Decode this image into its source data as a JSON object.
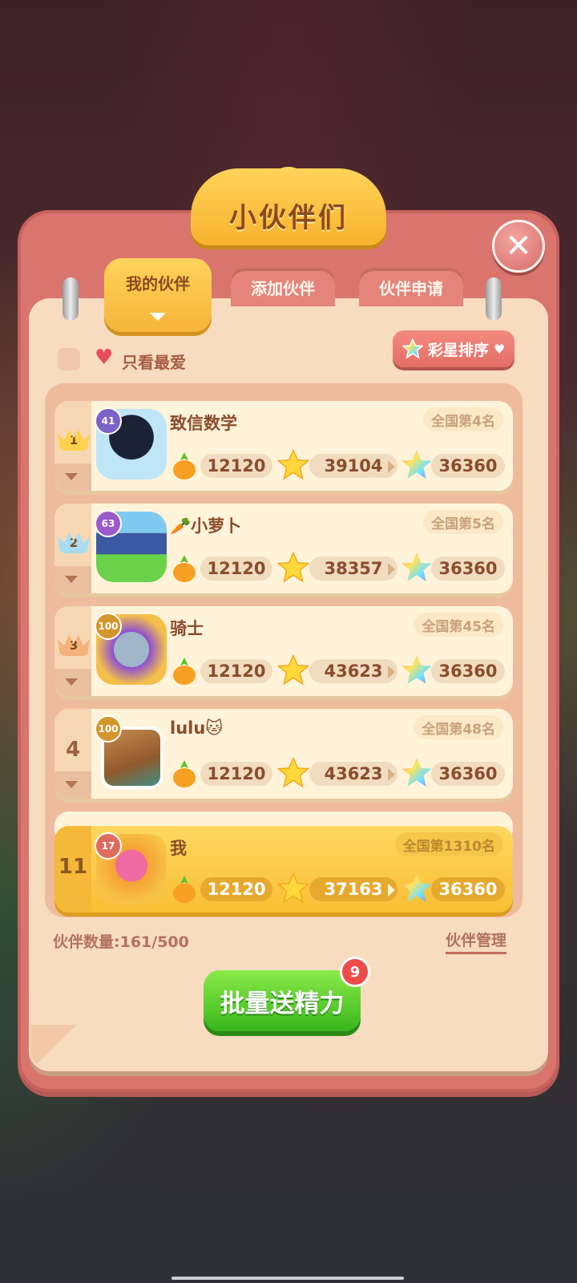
{
  "window": {
    "title": "小伙伴们"
  },
  "tabs": [
    {
      "label": "我的伙伴",
      "active": true
    },
    {
      "label": "添加伙伴",
      "active": false
    },
    {
      "label": "伙伴申请",
      "active": false
    }
  ],
  "filter": {
    "favorites_label": "只看最爱",
    "checked": false
  },
  "sort": {
    "label": "彩星排序",
    "icon": "rainbow-star-icon"
  },
  "friends": [
    {
      "rank": "1",
      "crown": "gold",
      "level": "41",
      "name": "致信数学",
      "national": "全国第4名",
      "carrots": "12120",
      "stars": "39104",
      "rainbow": "36360"
    },
    {
      "rank": "2",
      "crown": "silver",
      "level": "63",
      "name": "🥕小萝卜",
      "national": "全国第5名",
      "carrots": "12120",
      "stars": "38357",
      "rainbow": "36360"
    },
    {
      "rank": "3",
      "crown": "bronze",
      "level": "100",
      "name": "骑士",
      "national": "全国第45名",
      "carrots": "12120",
      "stars": "43623",
      "rainbow": "36360"
    },
    {
      "rank": "4",
      "crown": "none",
      "level": "100",
      "name": "lulu🐱",
      "national": "全国第48名",
      "carrots": "12120",
      "stars": "43623",
      "rainbow": "36360"
    }
  ],
  "me": {
    "rank": "11",
    "level": "17",
    "name": "我",
    "national": "全国第1310名",
    "carrots": "12120",
    "stars": "37163",
    "rainbow": "36360"
  },
  "footer": {
    "count_label": "伙伴数量:161/500",
    "manage_label": "伙伴管理"
  },
  "send_button": {
    "label": "批量送精力",
    "badge": "9"
  },
  "colors": {
    "frame": "#d9756d",
    "paper": "#f7dcbf",
    "accent_yellow": "#f7b22d",
    "green_button": "#37b61b"
  }
}
